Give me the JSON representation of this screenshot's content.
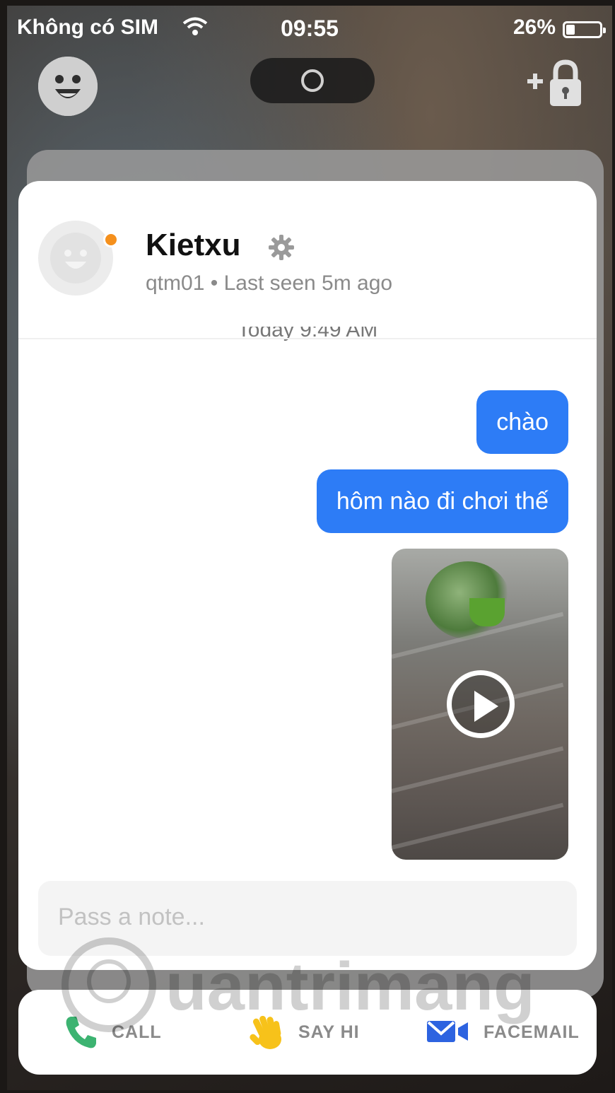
{
  "status_bar": {
    "carrier": "Không có SIM",
    "time": "09:55",
    "battery_percent_label": "26%",
    "battery_level": 0.26
  },
  "top_controls": {
    "left_icon": "smiley-icon",
    "center_icon": "camera-shutter-icon",
    "right_icon": "add-lock-icon"
  },
  "contact": {
    "name": "Kietxu",
    "username": "qtm01",
    "last_seen": "Last seen 5m ago",
    "subline_separator": "•",
    "online_status_color": "#f5901c",
    "settings_icon": "gear-icon"
  },
  "chat": {
    "timestamp": "Today 9:49 AM",
    "messages": [
      {
        "text": "chào"
      },
      {
        "text": "hôm nào đi chơi thế"
      }
    ],
    "video_icon": "play-icon",
    "bubble_color": "#2d7cf6"
  },
  "composer": {
    "placeholder": "Pass a note..."
  },
  "actions": [
    {
      "label": "CALL",
      "icon": "phone-icon",
      "color": "#3cb371"
    },
    {
      "label": "SAY HI",
      "icon": "waving-hand-icon",
      "color": "#f7c21a"
    },
    {
      "label": "FACEMAIL",
      "icon": "facemail-icon",
      "color": "#2d63e0"
    }
  ],
  "watermark": "Quantrimang"
}
